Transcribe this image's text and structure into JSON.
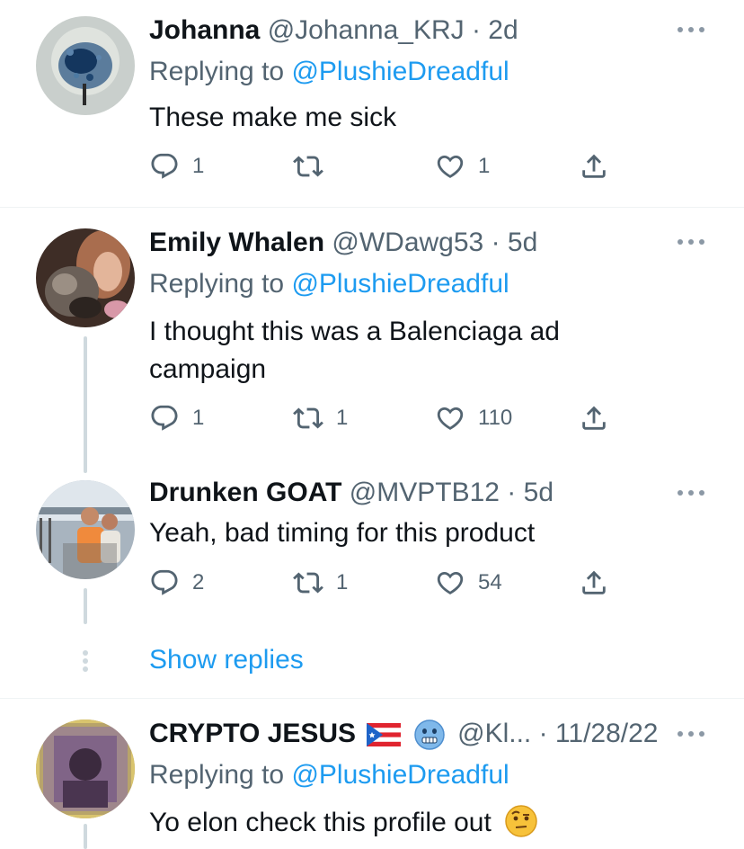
{
  "tweets": [
    {
      "name": "Johanna",
      "handle": "@Johanna_KRJ",
      "sep": " · ",
      "time": "2d",
      "replying_prefix": "Replying to ",
      "replying_to": "@PlushieDreadful",
      "text": "These make me sick",
      "reply_count": "1",
      "retweet_count": "",
      "like_count": "1"
    },
    {
      "name": "Emily Whalen",
      "handle": "@WDawg53",
      "sep": " · ",
      "time": "5d",
      "replying_prefix": "Replying to ",
      "replying_to": "@PlushieDreadful",
      "text": "I thought this was a Balenciaga ad campaign",
      "reply_count": "1",
      "retweet_count": "1",
      "like_count": "110"
    },
    {
      "name": "Drunken GOAT",
      "handle": "@MVPTB12",
      "sep": " · ",
      "time": "5d",
      "text": "Yeah, bad timing for this product",
      "reply_count": "2",
      "retweet_count": "1",
      "like_count": "54"
    },
    {
      "name": "CRYPTO JESUS",
      "handle": "@Kl...",
      "sep": " · ",
      "time": "11/28/22",
      "replying_prefix": "Replying to ",
      "replying_to": "@PlushieDreadful",
      "text": "Yo elon check this profile out",
      "name_emojis": [
        "puerto-rico-flag-icon",
        "cold-face-icon"
      ],
      "text_emoji": "raised-eyebrow-face-icon"
    }
  ],
  "show_replies_label": "Show replies",
  "colors": {
    "link": "#1d9bf0",
    "secondary": "#536471",
    "thread": "#cfd9de",
    "divider": "#eff3f4"
  }
}
